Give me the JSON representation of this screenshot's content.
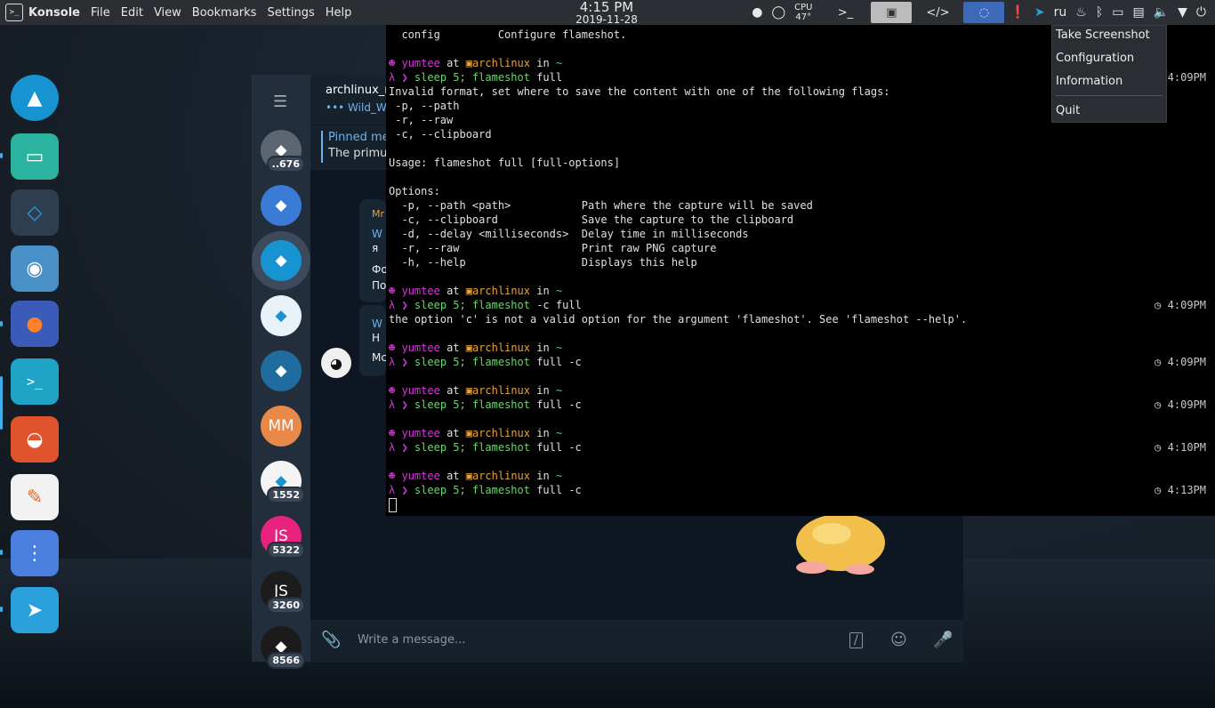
{
  "topbar": {
    "app_name": "Konsole",
    "menu": [
      "File",
      "Edit",
      "View",
      "Bookmarks",
      "Settings",
      "Help"
    ],
    "clock_time": "4:15 PM",
    "clock_date": "2019-11-28",
    "cpu_label": "CPU",
    "cpu_temp": "47°",
    "keyboard_layout": "ru"
  },
  "tray_menu": {
    "items": [
      "Take Screenshot",
      "Configuration",
      "Information",
      "Quit"
    ]
  },
  "telegram": {
    "chat_title": "archlinux_r",
    "chat_status": "••• Wild_W",
    "pinned_title": "Pinned me",
    "pinned_text": "The primus",
    "composer_placeholder": "Write a message...",
    "chats": [
      {
        "initials": "",
        "badge": "..676",
        "color": "#5c6570"
      },
      {
        "initials": "",
        "badge": "",
        "color": "#3a7bd5"
      },
      {
        "initials": "",
        "badge": "",
        "color": "#1793d1"
      },
      {
        "initials": "",
        "badge": "",
        "color": "#e9f2f8"
      },
      {
        "initials": "",
        "badge": "",
        "color": "#1f6d9e"
      },
      {
        "initials": "MM",
        "badge": "",
        "color": "#e8894a"
      },
      {
        "initials": "",
        "badge": "1552",
        "color": "#f4f4f4"
      },
      {
        "initials": "JS",
        "badge": "5322",
        "color": "#e8227f"
      },
      {
        "initials": "JS",
        "badge": "3260",
        "color": "#1c1c1c"
      },
      {
        "initials": "",
        "badge": "8566",
        "color": "#1b1b1b"
      }
    ],
    "msg_fragments": [
      "Mr",
      "W",
      "я",
      "Фо",
      "По",
      "W",
      "Н",
      "Мс"
    ]
  },
  "terminal": {
    "lines": [
      {
        "t": "  config         Configure flameshot."
      },
      {
        "prompt": true,
        "user": "yumtee",
        "host": "archlinux",
        "dir": "~"
      },
      {
        "cmd": true,
        "c1": "sleep 5; ",
        "c2": "flameshot",
        "c3": " full",
        "time": ""
      },
      {
        "t": "Invalid format, set where to save the content with one of the following flags:"
      },
      {
        "t": " -p, --path"
      },
      {
        "t": " -r, --raw"
      },
      {
        "t": " -c, --clipboard"
      },
      {
        "t": ""
      },
      {
        "t": "Usage: flameshot full [full-options]"
      },
      {
        "t": ""
      },
      {
        "t": "Options:"
      },
      {
        "t": "  -p, --path <path>           Path where the capture will be saved"
      },
      {
        "t": "  -c, --clipboard             Save the capture to the clipboard"
      },
      {
        "t": "  -d, --delay <milliseconds>  Delay time in milliseconds"
      },
      {
        "t": "  -r, --raw                   Print raw PNG capture"
      },
      {
        "t": "  -h, --help                  Displays this help"
      },
      {
        "t": ""
      },
      {
        "prompt": true,
        "user": "yumtee",
        "host": "archlinux",
        "dir": "~"
      },
      {
        "cmd": true,
        "c1": "sleep 5; ",
        "c2": "flameshot",
        "c3": " -c full",
        "time": "4:09PM"
      },
      {
        "t": "the option 'c' is not a valid option for the argument 'flameshot'. See 'flameshot --help'."
      },
      {
        "t": ""
      },
      {
        "prompt": true,
        "user": "yumtee",
        "host": "archlinux",
        "dir": "~"
      },
      {
        "cmd": true,
        "c1": "sleep 5; ",
        "c2": "flameshot",
        "c3": " full -c",
        "time": "4:09PM"
      },
      {
        "t": ""
      },
      {
        "prompt": true,
        "user": "yumtee",
        "host": "archlinux",
        "dir": "~"
      },
      {
        "cmd": true,
        "c1": "sleep 5; ",
        "c2": "flameshot",
        "c3": " full -c",
        "time": "4:09PM"
      },
      {
        "t": ""
      },
      {
        "prompt": true,
        "user": "yumtee",
        "host": "archlinux",
        "dir": "~"
      },
      {
        "cmd": true,
        "c1": "sleep 5; ",
        "c2": "flameshot",
        "c3": " full -c",
        "time": "4:10PM"
      },
      {
        "t": ""
      },
      {
        "prompt": true,
        "user": "yumtee",
        "host": "archlinux",
        "dir": "~"
      },
      {
        "cmd": true,
        "c1": "sleep 5; ",
        "c2": "flameshot",
        "c3": " full -c",
        "time": "4:13PM"
      }
    ],
    "first_time": "4:09PM",
    "at_word": "at",
    "in_word": "in",
    "lambda": "λ ❯"
  },
  "dock": {
    "items": [
      {
        "name": "arch-linux-icon",
        "color": "#1793d1"
      },
      {
        "name": "file-manager-icon",
        "color": "#2bb3a0"
      },
      {
        "name": "vscode-icon",
        "color": "#2c3e50"
      },
      {
        "name": "chromium-icon",
        "color": "#4a90c8"
      },
      {
        "name": "firefox-icon",
        "color": "#3a5bb8"
      },
      {
        "name": "terminal-icon",
        "color": "#1fa3c7"
      },
      {
        "name": "telegram-alt-icon",
        "color": "#e0532c"
      },
      {
        "name": "text-editor-icon",
        "color": "#f2f2f2"
      },
      {
        "name": "archive-icon",
        "color": "#4a7fe0"
      },
      {
        "name": "telegram-icon",
        "color": "#2aa1da"
      }
    ]
  }
}
